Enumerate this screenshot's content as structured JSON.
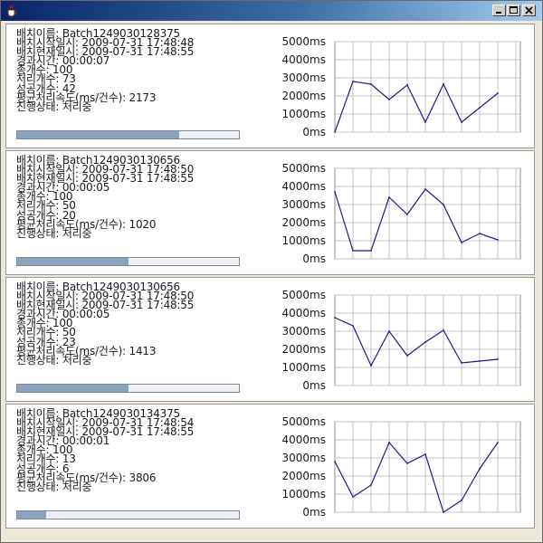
{
  "window": {
    "title": "",
    "colors": {
      "titlebar_start": "#0a246a",
      "titlebar_end": "#a6caf0",
      "chart_line": "#1c1c8c",
      "progress_fill": "#8aa4c0"
    }
  },
  "labels": {
    "batch_name": "배치이름: ",
    "start_time": "배치시작일시: ",
    "current_time": "배치현재일시: ",
    "elapsed": "경과시간: ",
    "total": "총개수: ",
    "processed": "처리개수: ",
    "success": "성공개수: ",
    "avg_speed": "평균처리속도(ms/건수): ",
    "status": "진행상태: "
  },
  "batches": [
    {
      "name": "Batch1249030128375",
      "start": "2009-07-31 17:48:48",
      "current": "2009-07-31 17:48:55",
      "elapsed": "00:00:07",
      "total": "100",
      "processed": "73",
      "success": "42",
      "avg": "2173",
      "status": "처리중",
      "progress": 0.73
    },
    {
      "name": "Batch1249030130656",
      "start": "2009-07-31 17:48:50",
      "current": "2009-07-31 17:48:55",
      "elapsed": "00:00:05",
      "total": "100",
      "processed": "50",
      "success": "20",
      "avg": "1020",
      "status": "처리중",
      "progress": 0.5
    },
    {
      "name": "Batch1249030130656",
      "start": "2009-07-31 17:48:50",
      "current": "2009-07-31 17:48:55",
      "elapsed": "00:00:05",
      "total": "100",
      "processed": "50",
      "success": "23",
      "avg": "1413",
      "status": "처리중",
      "progress": 0.5
    },
    {
      "name": "Batch1249030134375",
      "start": "2009-07-31 17:48:54",
      "current": "2009-07-31 17:48:55",
      "elapsed": "00:00:01",
      "total": "100",
      "processed": "13",
      "success": "6",
      "avg": "3806",
      "status": "처리중",
      "progress": 0.13
    }
  ],
  "chart_data": [
    {
      "type": "line",
      "ylim": [
        0,
        5000
      ],
      "yticks": [
        "0ms",
        "1000ms",
        "2000ms",
        "3000ms",
        "4000ms",
        "5000ms"
      ],
      "series": [
        {
          "values": [
            0,
            2800,
            2650,
            1800,
            2600,
            550,
            2650,
            550,
            1350,
            2150
          ]
        }
      ]
    },
    {
      "type": "line",
      "ylim": [
        0,
        5000
      ],
      "yticks": [
        "0ms",
        "1000ms",
        "2000ms",
        "3000ms",
        "4000ms",
        "5000ms"
      ],
      "series": [
        {
          "values": [
            3700,
            450,
            450,
            3400,
            2450,
            3850,
            3000,
            900,
            1400,
            1050
          ]
        }
      ]
    },
    {
      "type": "line",
      "ylim": [
        0,
        5000
      ],
      "yticks": [
        "0ms",
        "1000ms",
        "2000ms",
        "3000ms",
        "4000ms",
        "5000ms"
      ],
      "series": [
        {
          "values": [
            3750,
            3300,
            1100,
            3000,
            1650,
            2400,
            3050,
            1250,
            1350,
            1450
          ]
        }
      ]
    },
    {
      "type": "line",
      "ylim": [
        0,
        5000
      ],
      "yticks": [
        "0ms",
        "1000ms",
        "2000ms",
        "3000ms",
        "4000ms",
        "5000ms"
      ],
      "series": [
        {
          "values": [
            2800,
            850,
            1500,
            3850,
            2700,
            3200,
            0,
            650,
            2400,
            3850
          ]
        }
      ]
    }
  ]
}
